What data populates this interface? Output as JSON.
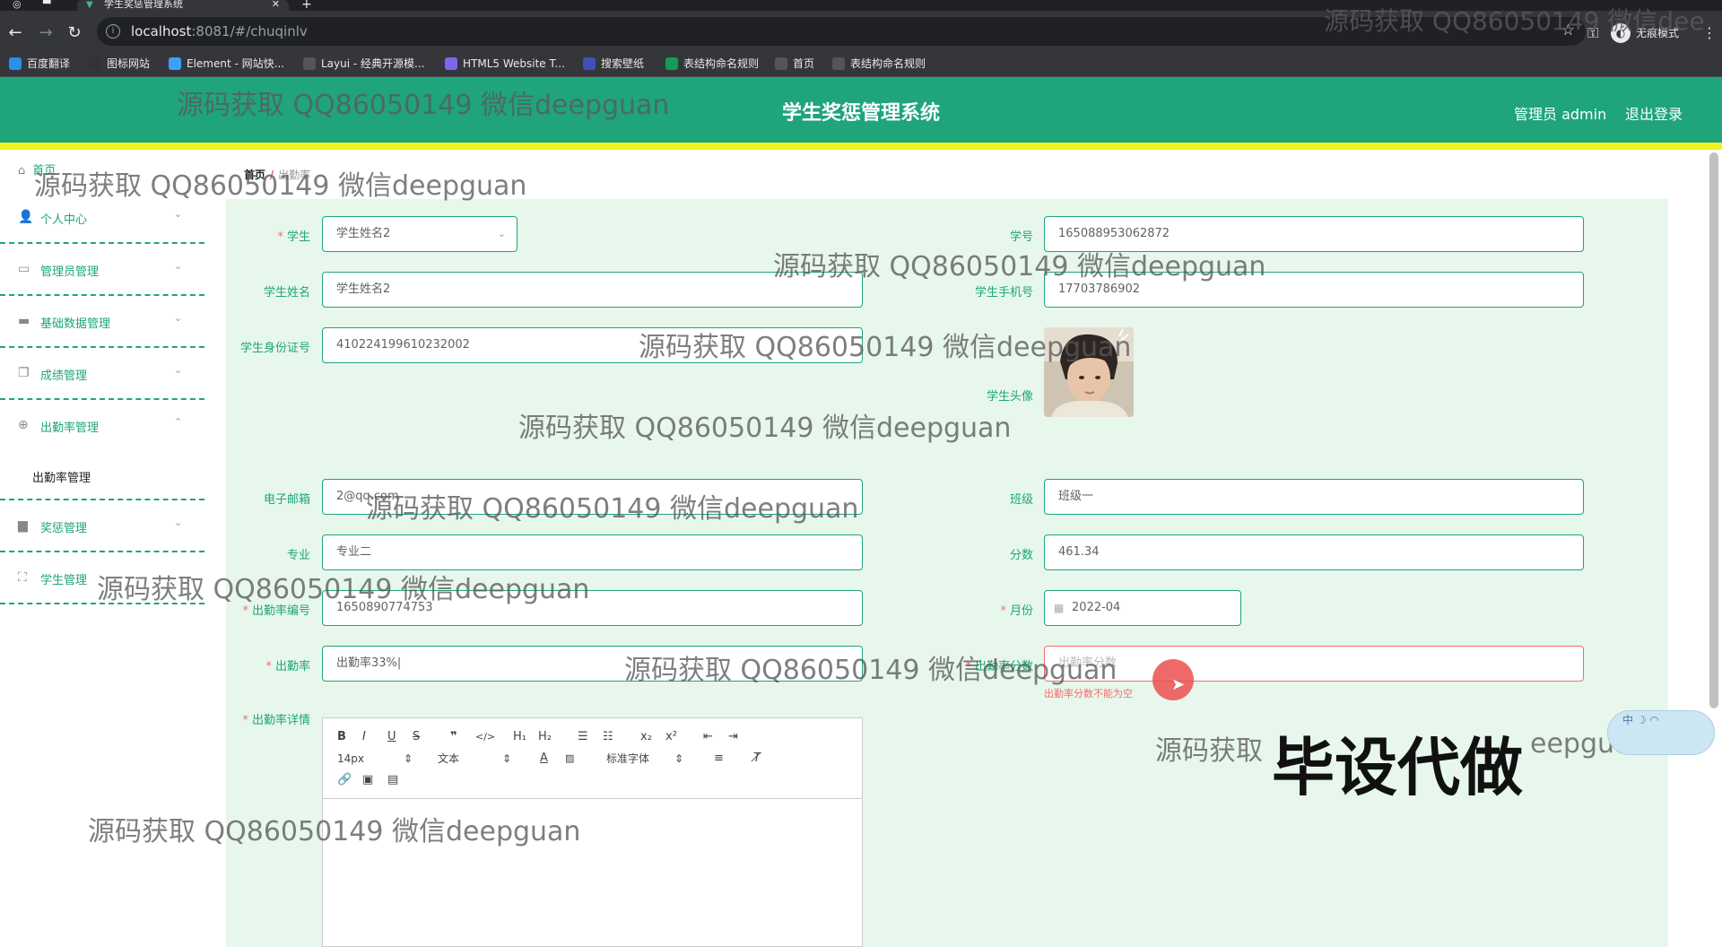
{
  "browser": {
    "tab_title": "学生奖惩管理系统",
    "url_host": "localhost",
    "url_path": ":8081/#/chuqinlv",
    "incognito_label": "无痕模式",
    "bookmarks": [
      {
        "label": "百度翻译",
        "color": "#2d8cf0"
      },
      {
        "label": "图标网站",
        "color": "#333333"
      },
      {
        "label": "Element - 网站快...",
        "color": "#409eff"
      },
      {
        "label": "Layui - 经典开源模...",
        "color": "#555555"
      },
      {
        "label": "HTML5 Website T...",
        "color": "#7b68ee"
      },
      {
        "label": "搜索壁纸",
        "color": "#3f51b5"
      },
      {
        "label": "表结构命名规则",
        "color": "#0f9d58"
      },
      {
        "label": "首页",
        "color": "#555555"
      },
      {
        "label": "表结构命名规则",
        "color": "#555555"
      }
    ]
  },
  "header": {
    "title": "学生奖惩管理系统",
    "admin": "管理员 admin",
    "logout": "退出登录"
  },
  "sidebar": {
    "home": "首页",
    "items": [
      {
        "label": "个人中心",
        "icon": "user-icon"
      },
      {
        "label": "管理员管理",
        "icon": "chat-icon"
      },
      {
        "label": "基础数据管理",
        "icon": "message-icon"
      },
      {
        "label": "成绩管理",
        "icon": "copy-icon"
      },
      {
        "label": "出勤率管理",
        "icon": "globe-icon"
      },
      {
        "label": "奖惩管理",
        "icon": "printer-icon"
      },
      {
        "label": "学生管理",
        "icon": "fullscreen-icon"
      }
    ],
    "submenu": "出勤率管理"
  },
  "breadcrumb": {
    "home": "首页",
    "current": "出勤率"
  },
  "form": {
    "student_label": "学生",
    "student_value": "学生姓名2",
    "student_no_label": "学号",
    "student_no_value": "165088953062872",
    "student_name_label": "学生姓名",
    "student_name_value": "学生姓名2",
    "phone_label": "学生手机号",
    "phone_value": "17703786902",
    "idcard_label": "学生身份证号",
    "idcard_value": "410224199610232002",
    "avatar_label": "学生头像",
    "email_label": "电子邮箱",
    "email_value": "2@qq.com",
    "class_label": "班级",
    "class_value": "班级一",
    "major_label": "专业",
    "major_value": "专业二",
    "score_label": "分数",
    "score_value": "461.34",
    "record_no_label": "出勤率编号",
    "record_no_value": "1650890774753",
    "month_label": "月份",
    "month_value": "2022-04",
    "rate_label": "出勤率",
    "rate_value": "出勤率33%|",
    "rate_score_label": "出勤率分数",
    "rate_score_placeholder": "出勤率分数",
    "rate_score_error": "出勤率分数不能为空",
    "detail_label": "出勤率详情"
  },
  "editor": {
    "font_size": "14px",
    "text_type": "文本",
    "font_family": "标准字体"
  },
  "watermark_text": "源码获取 QQ86050149 微信deepguan",
  "watermark_partial": "源码获取 QQ86050149 微信dee",
  "watermark_left_part": "源码获取",
  "watermark_right_part": "eepguan",
  "overlay_text": "毕设代做",
  "ime_label": "中"
}
